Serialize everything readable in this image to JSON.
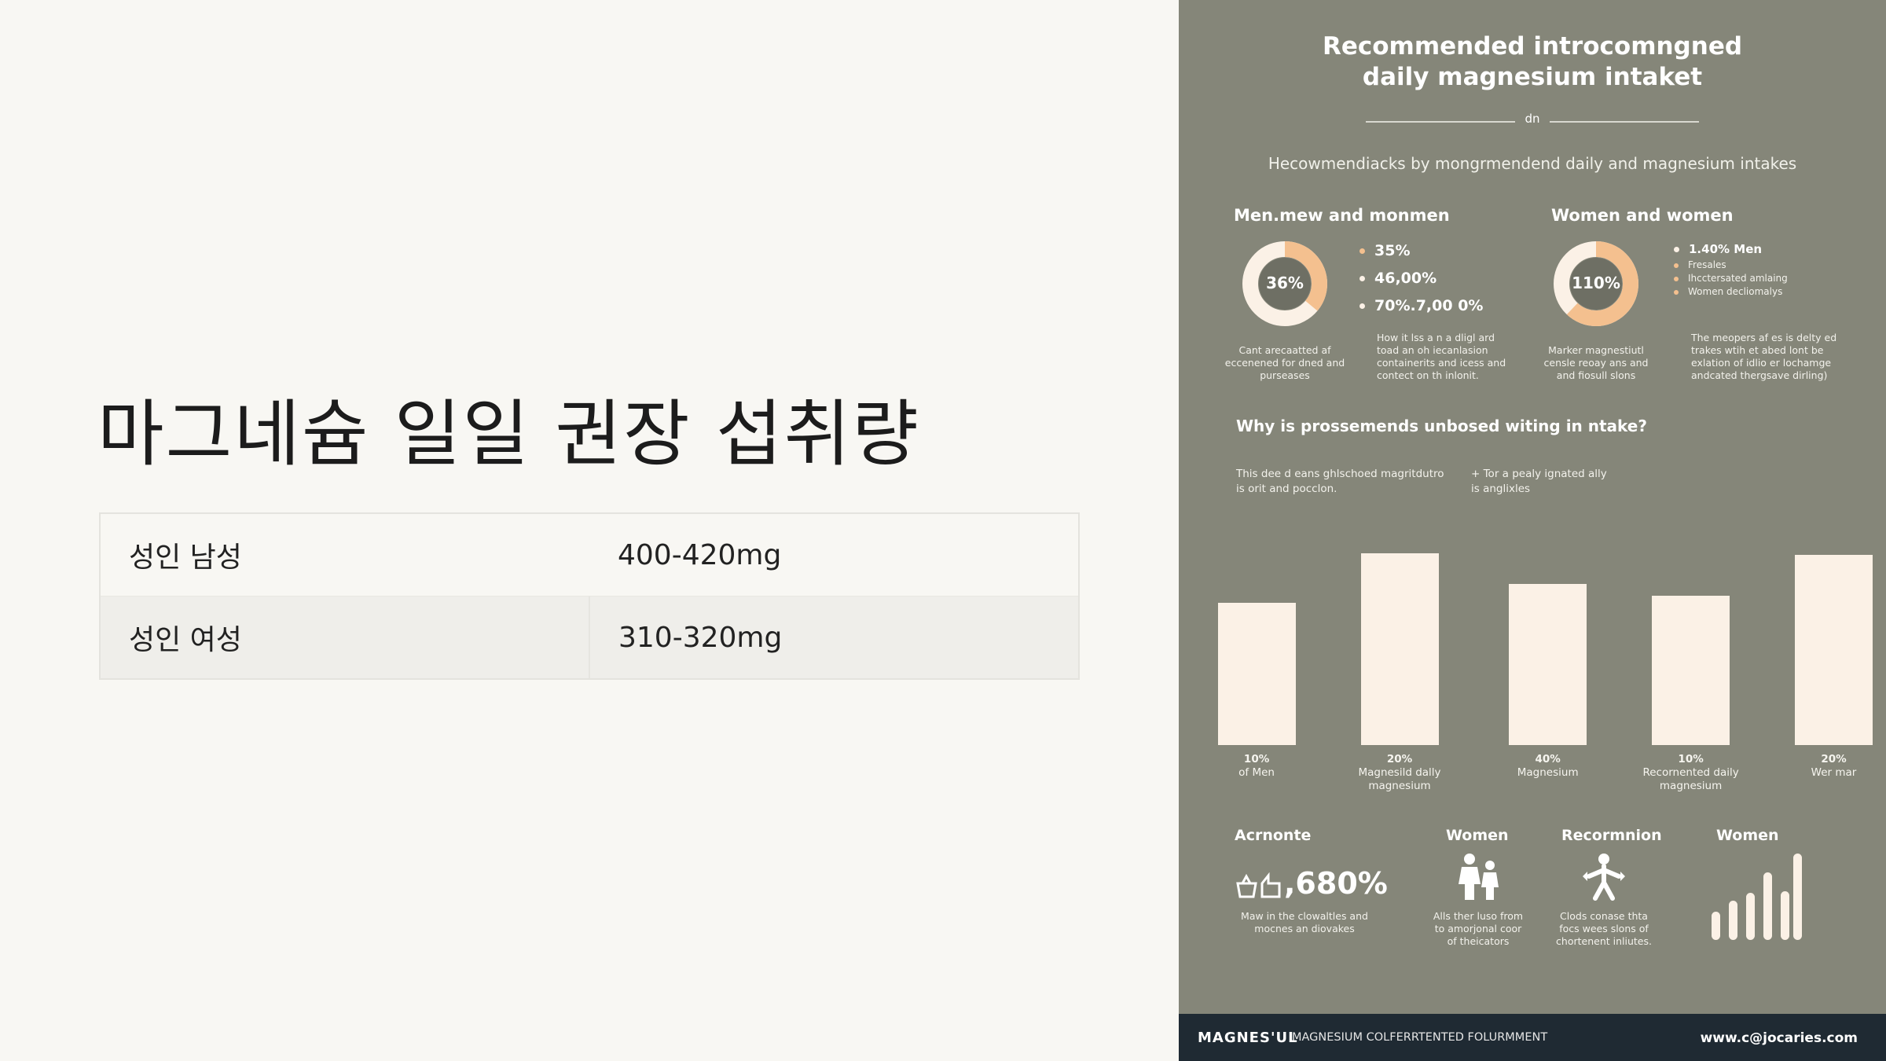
{
  "slide": {
    "title": "마그네슘 일일 권장 섭취량",
    "table": [
      {
        "group": "성인 남성",
        "amount": "400-420mg"
      },
      {
        "group": "성인 여성",
        "amount": "310-320mg"
      }
    ]
  },
  "poster": {
    "title_line1": "Recommended introcomngned",
    "title_line2": "daily magnesium intaket",
    "divider_mark": "dn",
    "subtitle": "Hecowmendiacks by mongrmendend daily and magnesium intakes",
    "men": {
      "heading": "Men.mew and monmen",
      "donut_value": "36%",
      "donut_fraction": 0.36,
      "caption": "Cant arecaatted af\neccenened for dned and\npurseases",
      "bullets": [
        "35%",
        "46,00%",
        "70%.7,00 0%"
      ],
      "desc": "How it lss a n a dligl ard\ntoad an oh iecanlasion\ncontainerits and icess and\ncontect on th inlonit."
    },
    "women": {
      "heading": "Women and women",
      "donut_value": "110%",
      "donut_fraction": 0.62,
      "caption": "Marker magnestiutl\ncensle reoay ans and\nand fiosull slons",
      "bullet_main": "1.40% Men",
      "bullets_small": [
        "Fresales",
        "Ihcctersated amlaing",
        "Women decliomalys"
      ],
      "desc": "The meopers af es is delty ed\ntrakes wtih et abed lont be\nexlation of idlio er lochamge\nandcated thergsave dirling)"
    },
    "why_heading": "Why is prossemends unbosed witing in ntake?",
    "why_left": "This dee d eans ghlschoed magritdutro\nis orit and pocclon.",
    "why_right": "+ Tor a pealy ignated ally\nis anglixles",
    "chart_data": {
      "type": "bar",
      "categories": [
        "10%\nof Men",
        "20%\nMagnesild dally\nmagnesium",
        "40%\nMagnesium",
        "10%\nRecornented daily\nmagnesium",
        "20%\nWer mar"
      ],
      "values": [
        0.74,
        1.0,
        0.84,
        0.78,
        0.99
      ],
      "colors": {
        "bar": "#fbf1e6"
      }
    },
    "bottom": [
      {
        "heading": "Acrnonte",
        "stat": ",680%",
        "caption": "Maw in the clowaltles and\nmocnes an diovakes"
      },
      {
        "heading": "Women",
        "caption": "Alls ther luso from\nto amorjonal coor\nof theicators"
      },
      {
        "heading": "Recormnion",
        "caption": "Clods conase thta\nfocs wees slons of\nchortenent inliutes."
      },
      {
        "heading": "Women"
      }
    ],
    "footer": {
      "brand": "MAGNES'UL",
      "text": "MAGNESIUM COLFERRTENTED FOLURMMENT",
      "url": "www.c@jocaries.com"
    },
    "colors": {
      "bg": "#858679",
      "accent": "#f4c08f",
      "ring": "#fbf1e6",
      "footer": "#1f2a33"
    }
  }
}
